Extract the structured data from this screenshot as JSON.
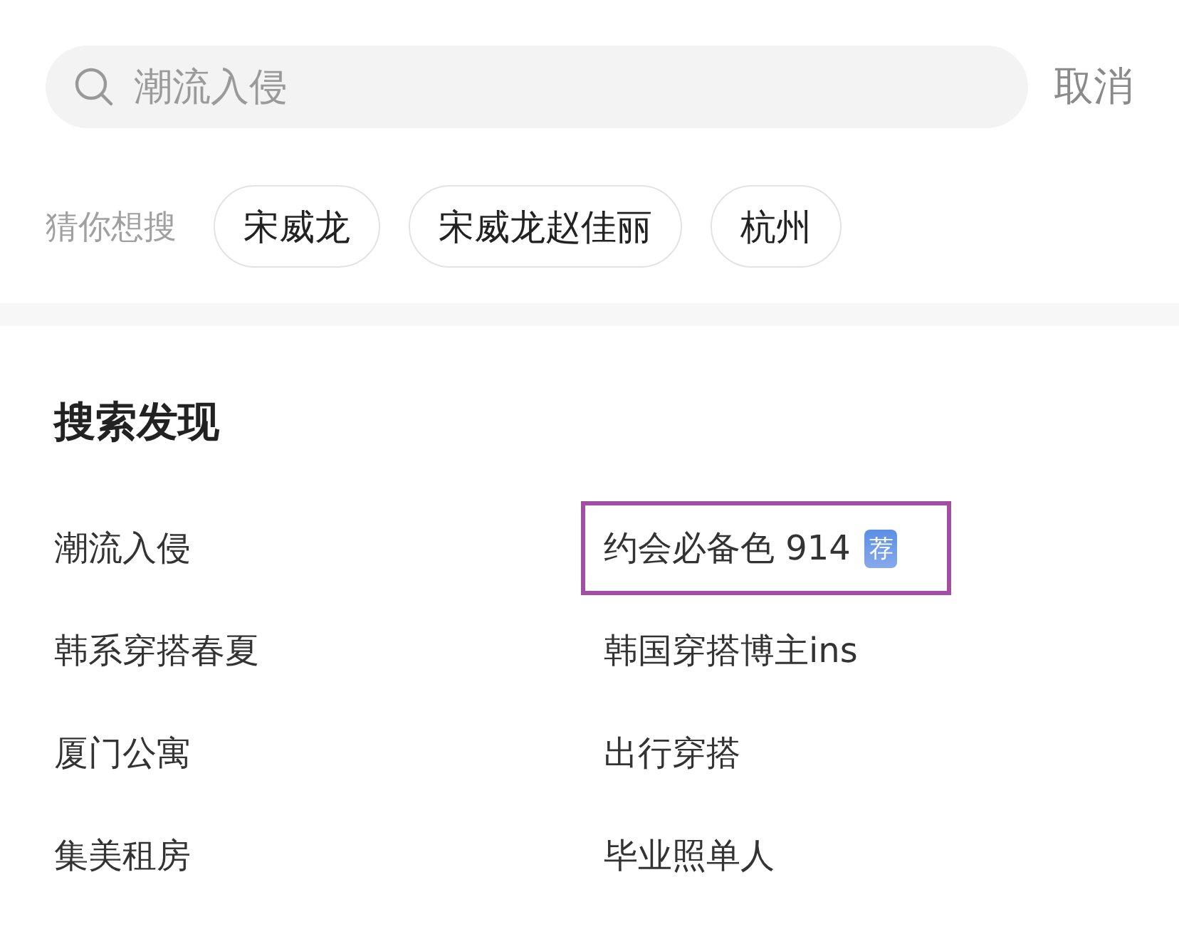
{
  "search": {
    "placeholder": "潮流入侵",
    "cancel": "取消"
  },
  "guess": {
    "label": "猜你想搜",
    "chips": [
      "宋威龙",
      "宋威龙赵佳丽",
      "杭州"
    ]
  },
  "discover": {
    "title": "搜索发现",
    "items": [
      {
        "text": "潮流入侵",
        "selected": false
      },
      {
        "text": "约会必备色 914",
        "badge": "荐",
        "selected": true
      },
      {
        "text": "韩系穿搭春夏",
        "selected": false
      },
      {
        "text": "韩国穿搭博主ins",
        "selected": false
      },
      {
        "text": "厦门公寓",
        "selected": false
      },
      {
        "text": "出行穿搭",
        "selected": false
      },
      {
        "text": "集美租房",
        "selected": false
      },
      {
        "text": "毕业照单人",
        "selected": false
      }
    ]
  }
}
